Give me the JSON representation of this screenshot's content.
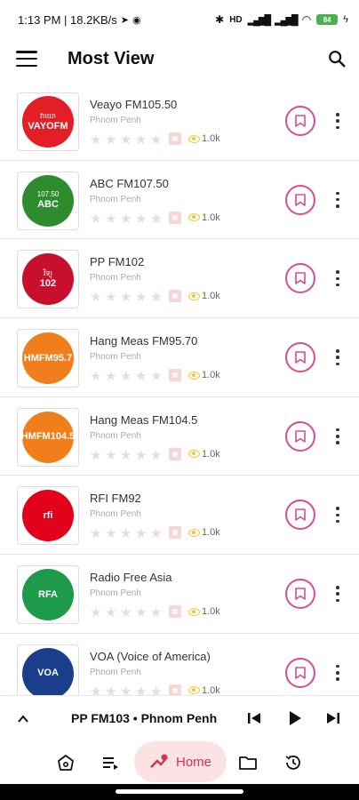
{
  "status_bar": {
    "left": "1:13 PM | 18.2KB/s",
    "battery": "84"
  },
  "header": {
    "title": "Most View"
  },
  "stations": [
    {
      "name": "Veayo FM105.50",
      "city": "Phnom Penh",
      "views": "1.0k",
      "logo_text": "VAYOFM",
      "logo_sub": "វាយោ",
      "logo_bg": "#e31e24"
    },
    {
      "name": "ABC FM107.50",
      "city": "Phnom Penh",
      "views": "1.0k",
      "logo_text": "ABC",
      "logo_sub": "107.50",
      "logo_bg": "#2e8b2e"
    },
    {
      "name": "PP FM102",
      "city": "Phnom Penh",
      "views": "1.0k",
      "logo_text": "102",
      "logo_sub": "វិទ្យុ",
      "logo_bg": "#c8102e"
    },
    {
      "name": "Hang Meas FM95.70",
      "city": "Phnom Penh",
      "views": "1.0k",
      "logo_text": "HMFM95.7",
      "logo_sub": "",
      "logo_bg": "#f07f1b"
    },
    {
      "name": "Hang Meas FM104.5",
      "city": "Phnom Penh",
      "views": "1.0k",
      "logo_text": "HMFM104.5",
      "logo_sub": "",
      "logo_bg": "#f07f1b"
    },
    {
      "name": "RFI FM92",
      "city": "Phnom Penh",
      "views": "1.0k",
      "logo_text": "rfi",
      "logo_sub": "",
      "logo_bg": "#e2001a"
    },
    {
      "name": "Radio Free Asia",
      "city": "Phnom Penh",
      "views": "1.0k",
      "logo_text": "RFA",
      "logo_sub": "",
      "logo_bg": "#1e9a4b"
    },
    {
      "name": "VOA (Voice of America)",
      "city": "Phnom Penh",
      "views": "1.0k",
      "logo_text": "VOA",
      "logo_sub": "",
      "logo_bg": "#1a3e8c"
    }
  ],
  "player": {
    "now_playing": "PP FM103 • Phnom Penh"
  },
  "nav": {
    "home_label": "Home"
  },
  "colors": {
    "accent": "#d8324b",
    "bookmark": "#d64e8a",
    "views_eye": "#f4c430"
  }
}
